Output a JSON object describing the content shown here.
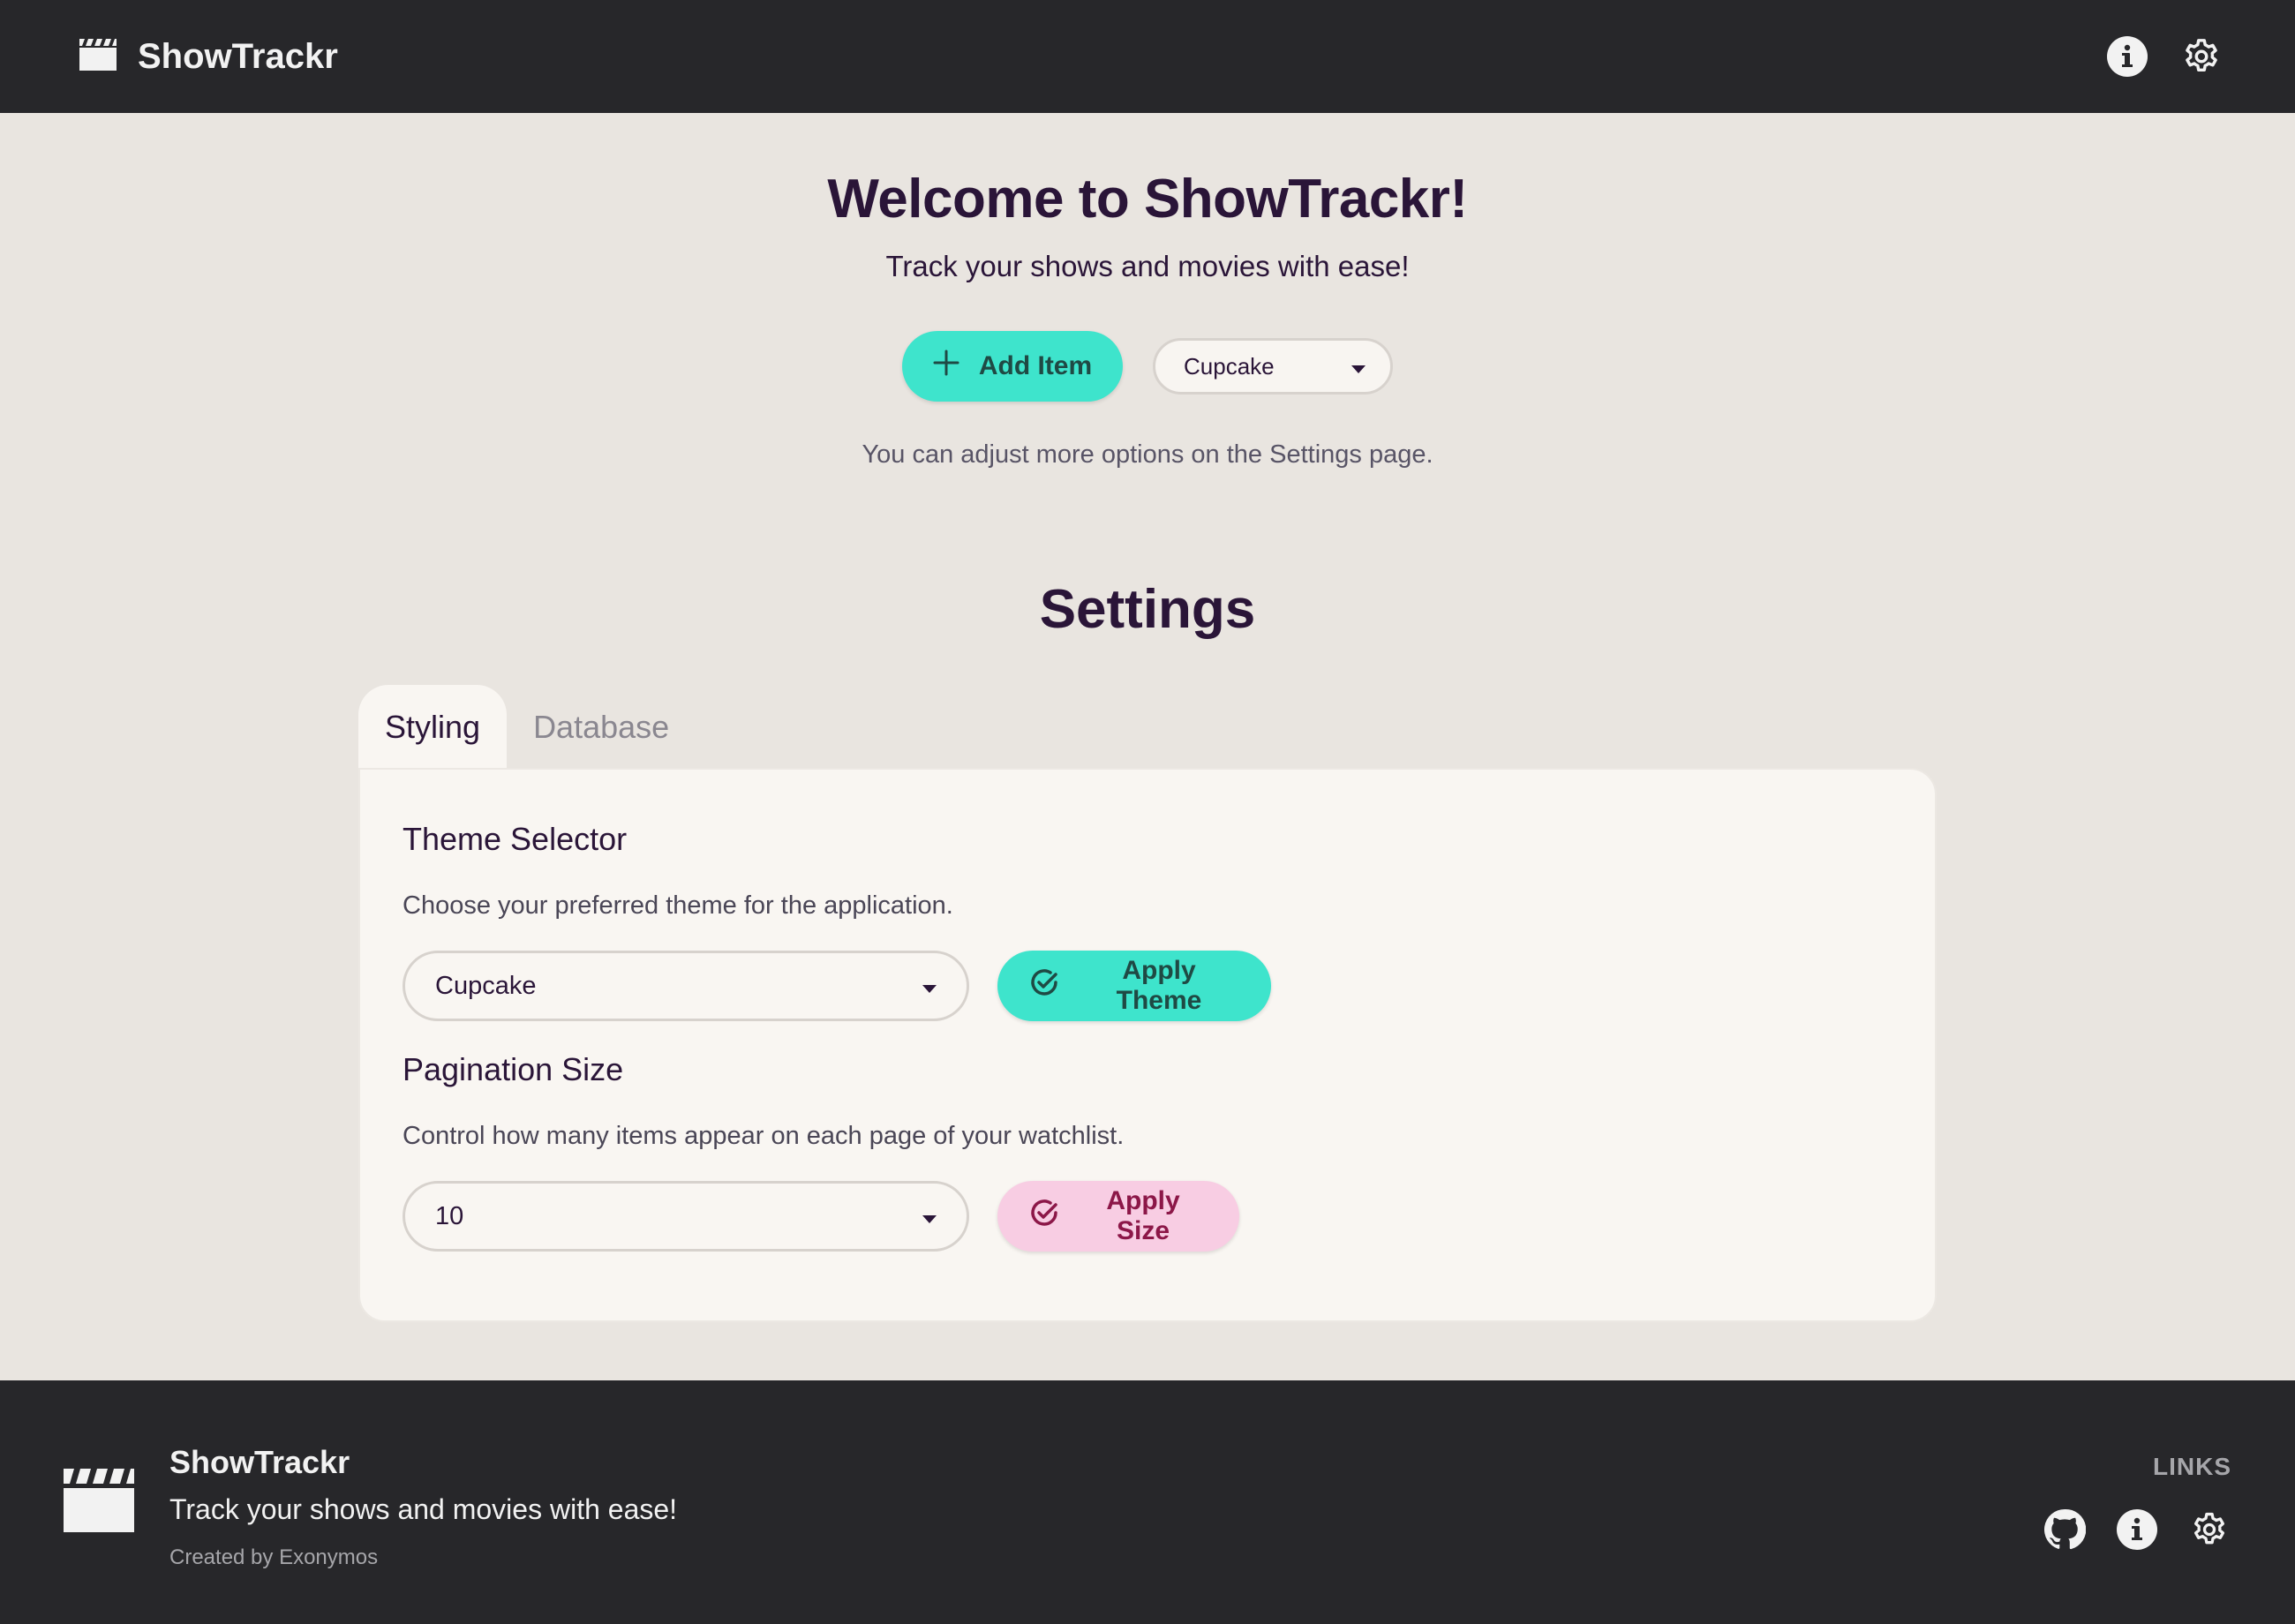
{
  "app": {
    "name": "ShowTrackr",
    "icons": {
      "logo": "clapperboard-icon",
      "info": "info-icon",
      "settings": "gear-icon",
      "github": "github-icon"
    }
  },
  "hero": {
    "title": "Welcome to ShowTrackr!",
    "subtitle": "Track your shows and movies with ease!",
    "add_button_label": "Add Item",
    "theme_select_value": "Cupcake",
    "hint": "You can adjust more options on the Settings page."
  },
  "settings": {
    "title": "Settings",
    "tabs": [
      {
        "label": "Styling",
        "active": true
      },
      {
        "label": "Database",
        "active": false
      }
    ],
    "theme": {
      "title": "Theme Selector",
      "description": "Choose your preferred theme for the application.",
      "select_value": "Cupcake",
      "apply_label": "Apply Theme"
    },
    "pagination": {
      "title": "Pagination Size",
      "description": "Control how many items appear on each page of your watchlist.",
      "select_value": "10",
      "apply_label": "Apply Size"
    }
  },
  "footer": {
    "brand": "ShowTrackr",
    "tagline": "Track your shows and movies with ease!",
    "credit": "Created by Exonymos",
    "links_title": "LINKS"
  },
  "colors": {
    "navbar_bg": "#27272a",
    "page_bg": "#e9e5e0",
    "primary": "#3ee4cc",
    "secondary": "#f8cde3",
    "secondary_text": "#8c1748",
    "heading": "#2a1538"
  }
}
